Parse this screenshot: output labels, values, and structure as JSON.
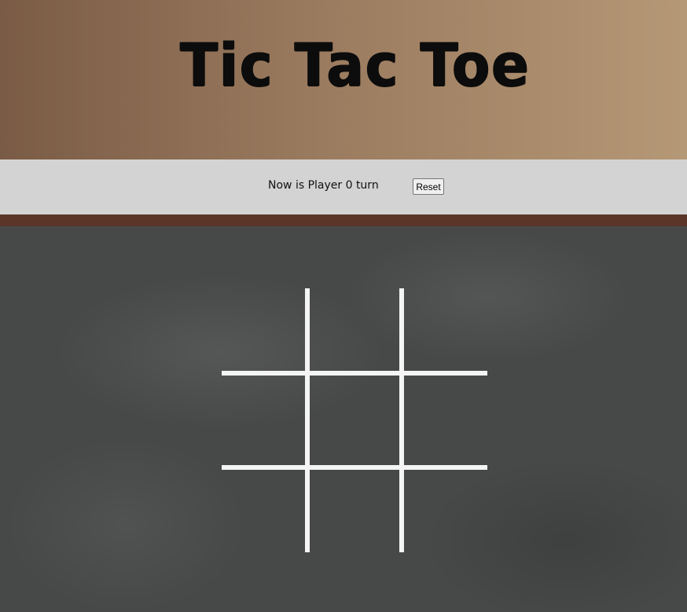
{
  "header": {
    "title": "Tic Tac Toe"
  },
  "status": {
    "text": "Now is Player 0 turn",
    "reset_label": "Reset"
  },
  "board": {
    "cells": [
      "",
      "",
      "",
      "",
      "",
      "",
      "",
      "",
      ""
    ],
    "line_color": "#f4f4f4",
    "background_color": "#474949"
  },
  "colors": {
    "header_start": "#7a5b45",
    "header_end": "#b59876",
    "status_bar": "#d3d3d3",
    "divider": "#5a3528"
  }
}
